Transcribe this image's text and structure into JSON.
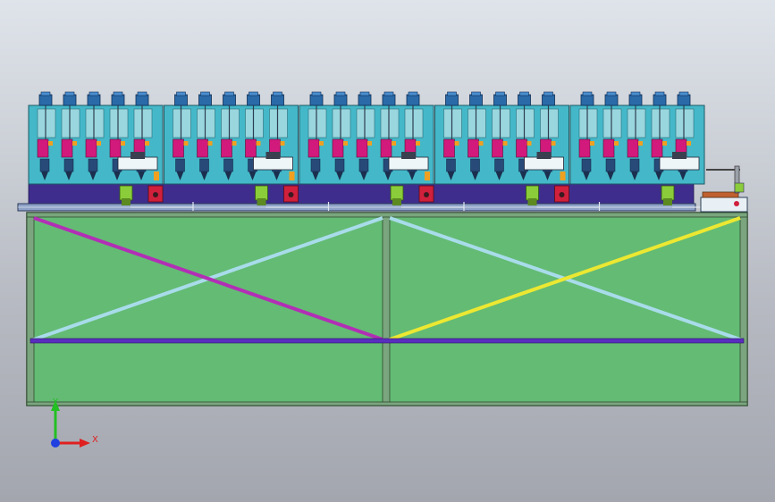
{
  "viewport": {
    "background_top": "#dfe3ea",
    "background_bottom": "#a3a6ae"
  },
  "machine": {
    "module_count": 5,
    "spindles_per_module": 5,
    "colors": {
      "frame_fill": "#64bb74",
      "frame_edge": "#2f4a2f",
      "post": "#7aa57e",
      "module_panel": "#44b8c8",
      "module_slot": "#9ad6de",
      "spindle_head": "#2a6aa8",
      "spindle_cap": "#4a8ed0",
      "clamp_magenta": "#d21a7c",
      "clamp_orange": "#f0a020",
      "rail_base": "#3e2d8c",
      "rail_bar": "#8fa3c8",
      "motor_green": "#8acc3a",
      "motor_red": "#d0203c",
      "brace_magenta": "#b22fb5",
      "brace_cyan": "#a8dcea",
      "brace_yellow": "#ece832",
      "crossbar_purple": "#5a2ec0"
    }
  },
  "triad": {
    "x_label": "X",
    "y_label": "Y",
    "x_color": "#e02020",
    "y_color": "#22c022",
    "z_color": "#2040e0"
  }
}
